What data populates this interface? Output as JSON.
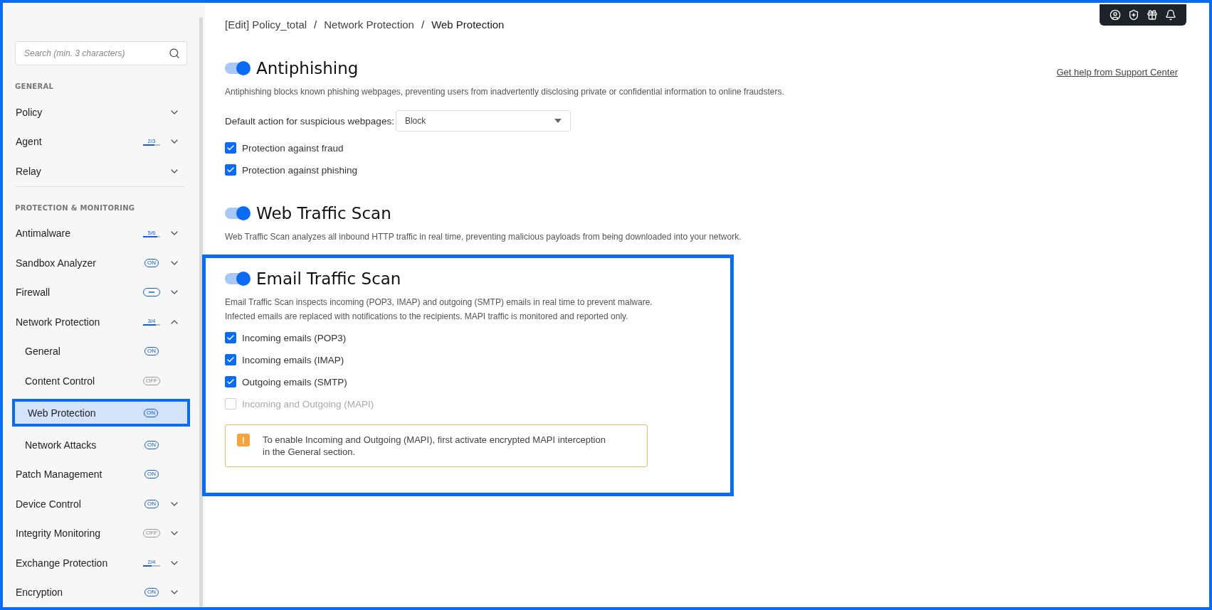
{
  "sidebar": {
    "search": {
      "placeholder": "Search (min. 3 characters)"
    },
    "groups": [
      {
        "title": "GENERAL",
        "items": [
          {
            "label": "Policy",
            "expanded": false,
            "selected": false
          },
          {
            "label": "Agent",
            "badge": {
              "kind": "progress",
              "text": "2/3",
              "level": 0.67
            },
            "expanded": false,
            "selected": false
          },
          {
            "label": "Relay",
            "expanded": false,
            "selected": false
          }
        ]
      },
      {
        "title": "PROTECTION & MONITORING",
        "items": [
          {
            "label": "Antimalware",
            "badge": {
              "kind": "progress",
              "text": "5/6",
              "level": 0.83
            },
            "expanded": false,
            "selected": false
          },
          {
            "label": "Sandbox Analyzer",
            "badge": {
              "kind": "status",
              "text": "ON",
              "on": true
            },
            "expanded": false,
            "selected": false
          },
          {
            "label": "Firewall",
            "badge": {
              "kind": "partial"
            },
            "expanded": false,
            "selected": false
          },
          {
            "label": "Network Protection",
            "badge": {
              "kind": "progress",
              "text": "3/4",
              "level": 0.75
            },
            "expanded": true,
            "selected": false,
            "children": [
              {
                "label": "General",
                "badge": {
                  "kind": "status",
                  "text": "ON",
                  "on": true
                },
                "selected": false
              },
              {
                "label": "Content Control",
                "badge": {
                  "kind": "status",
                  "text": "OFF",
                  "on": false
                },
                "selected": false
              },
              {
                "label": "Web Protection",
                "badge": {
                  "kind": "status",
                  "text": "ON",
                  "on": true
                },
                "selected": true
              },
              {
                "label": "Network Attacks",
                "badge": {
                  "kind": "status",
                  "text": "ON",
                  "on": true
                },
                "selected": false
              }
            ]
          },
          {
            "label": "Patch Management",
            "badge": {
              "kind": "status",
              "text": "ON",
              "on": true
            },
            "selected": false
          },
          {
            "label": "Device Control",
            "badge": {
              "kind": "status",
              "text": "ON",
              "on": true
            },
            "expanded": false,
            "selected": false
          },
          {
            "label": "Integrity Monitoring",
            "badge": {
              "kind": "status",
              "text": "OFF",
              "on": false
            },
            "expanded": false,
            "selected": false
          },
          {
            "label": "Exchange Protection",
            "badge": {
              "kind": "progress",
              "text": "2/4",
              "level": 0.5
            },
            "expanded": false,
            "selected": false
          },
          {
            "label": "Encryption",
            "badge": {
              "kind": "status",
              "text": "ON",
              "on": true
            },
            "expanded": false,
            "selected": false
          }
        ]
      }
    ]
  },
  "breadcrumb": {
    "separator": "/",
    "items": [
      "[Edit] Policy_total",
      "Network Protection",
      "Web Protection"
    ]
  },
  "help_link": "Get help from Support Center",
  "sections": [
    {
      "title": "Antiphishing",
      "on": true,
      "highlighted": false,
      "description": [
        "Antiphishing blocks known phishing webpages, preventing users from inadvertently disclosing private or confidential information to online fraudsters."
      ],
      "fields": [
        {
          "kind": "select",
          "label": "Default action for suspicious webpages:",
          "value": "Block"
        },
        {
          "kind": "checkbox",
          "label": "Protection against fraud",
          "checked": true,
          "disabled": false
        },
        {
          "kind": "checkbox",
          "label": "Protection against phishing",
          "checked": true,
          "disabled": false
        }
      ]
    },
    {
      "title": "Web Traffic Scan",
      "on": true,
      "highlighted": false,
      "description": [
        "Web Traffic Scan analyzes all inbound HTTP traffic in real time, preventing malicious payloads from being downloaded into your network."
      ]
    },
    {
      "title": "Email Traffic Scan",
      "on": true,
      "highlighted": true,
      "description": [
        "Email Traffic Scan inspects incoming (POP3, IMAP) and outgoing (SMTP) emails in real time to prevent malware.",
        "Infected emails are replaced with notifications to the recipients. MAPI traffic is monitored and reported only."
      ],
      "fields": [
        {
          "kind": "checkbox",
          "label": "Incoming emails (POP3)",
          "checked": true,
          "disabled": false
        },
        {
          "kind": "checkbox",
          "label": "Incoming emails (IMAP)",
          "checked": true,
          "disabled": false
        },
        {
          "kind": "checkbox",
          "label": "Outgoing emails (SMTP)",
          "checked": true,
          "disabled": false
        },
        {
          "kind": "checkbox",
          "label": "Incoming and Outgoing (MAPI)",
          "checked": false,
          "disabled": true
        },
        {
          "kind": "alert",
          "icon": "!",
          "lines": [
            "To enable Incoming and Outgoing (MAPI), first activate encrypted MAPI interception",
            "in the General section."
          ]
        }
      ]
    }
  ]
}
